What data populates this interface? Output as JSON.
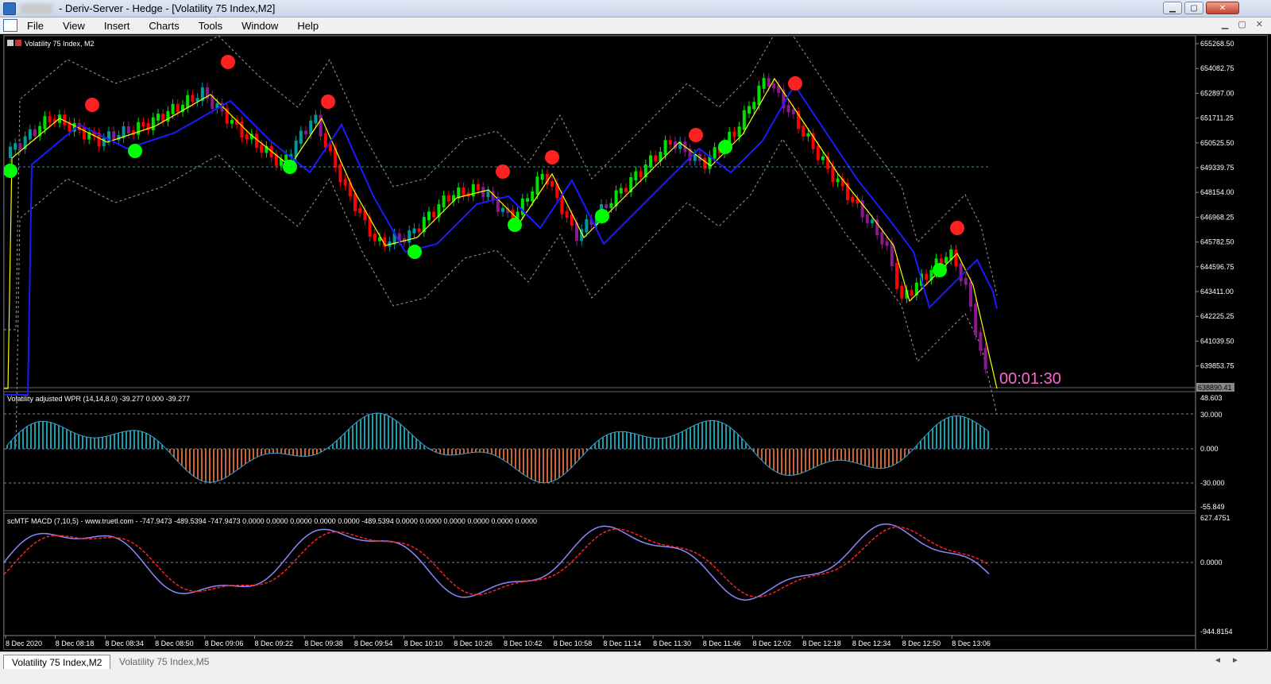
{
  "window": {
    "title": "- Deriv-Server - Hedge - [Volatility 75 Index,M2]",
    "btn_min": "▁",
    "btn_max": "▢",
    "btn_close": "✕"
  },
  "menu": [
    "File",
    "View",
    "Insert",
    "Charts",
    "Tools",
    "Window",
    "Help"
  ],
  "chart": {
    "symbol_label": "Volatility 75 Index, M2",
    "countdown": "00:01:30",
    "current_price_label": "638890.41",
    "price_labels": [
      "655268.50",
      "654082.75",
      "652897.00",
      "651711.25",
      "650525.50",
      "649339.75",
      "648154.00",
      "646968.25",
      "645782.50",
      "644596.75",
      "643411.00",
      "642225.25",
      "641039.50",
      "639853.75"
    ],
    "wpr_title": "Volatility adjusted WPR (14,14,8.0) -39.277 0.000 -39.277",
    "wpr_levels": [
      "48.603",
      "30.000",
      "0.000",
      "-30.000",
      "-55.849"
    ],
    "macd_title": "scMTF MACD (7,10,5) - www.truetl.com - -747.9473 -489.5394 -747.9473 0.0000 0.0000 0.0000 0.0000 0.0000 -489.5394 0.0000 0.0000 0.0000 0.0000 0.0000 0.0000",
    "macd_levels": [
      "627.4751",
      "0.0000",
      "-944.8154"
    ],
    "time_labels": [
      "8 Dec 2020",
      "8 Dec 08:18",
      "8 Dec 08:34",
      "8 Dec 08:50",
      "8 Dec 09:06",
      "8 Dec 09:22",
      "8 Dec 09:38",
      "8 Dec 09:54",
      "8 Dec 10:10",
      "8 Dec 10:26",
      "8 Dec 10:42",
      "8 Dec 10:58",
      "8 Dec 11:14",
      "8 Dec 11:30",
      "8 Dec 11:46",
      "8 Dec 12:02",
      "8 Dec 12:18",
      "8 Dec 12:34",
      "8 Dec 12:50",
      "8 Dec 13:06"
    ],
    "colors": {
      "bull": "#00e000",
      "bull_alt": "#009999",
      "bear": "#ff0000",
      "bear_alt": "#8b1a8b",
      "fast_ma": "#ffff00",
      "slow_ma": "#1a1aff",
      "bands": "#9a9a9a",
      "buy_dot": "#00ff00",
      "sell_dot": "#ff2020",
      "countdown": "#ff66cc",
      "wpr_up": "#1e9aa8",
      "wpr_down": "#c86432",
      "macd_main": "#8888ff",
      "macd_signal": "#ff2020"
    }
  },
  "tabs": [
    "Volatility 75 Index,M2",
    "Volatility 75 Index,M5"
  ]
}
